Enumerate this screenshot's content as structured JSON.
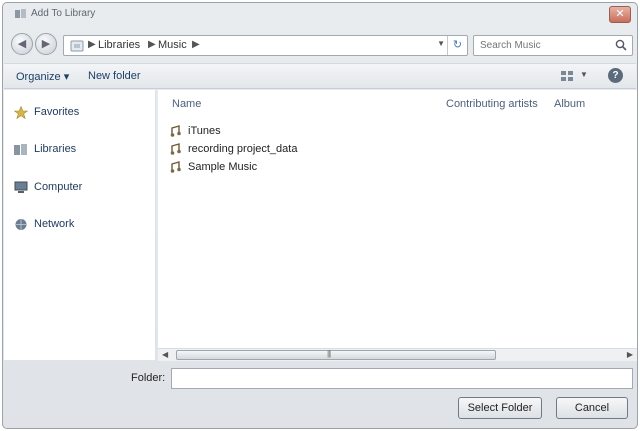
{
  "window": {
    "title": "Add To Library",
    "close_glyph": "✕"
  },
  "address": {
    "back_glyph": "◀",
    "forward_glyph": "▶",
    "separator": "▶",
    "crumbs": [
      "Libraries",
      "Music"
    ],
    "dropdown_glyph": "▼",
    "refresh_glyph": "↻"
  },
  "search": {
    "placeholder": "Search Music"
  },
  "toolbar": {
    "organize": "Organize ▾",
    "new_folder": "New folder",
    "view_arrow": "▼",
    "help": "?"
  },
  "nav": {
    "items": [
      {
        "label": "Favorites",
        "icon": "star-icon"
      },
      {
        "label": "Libraries",
        "icon": "libraries-icon"
      },
      {
        "label": "Computer",
        "icon": "computer-icon"
      },
      {
        "label": "Network",
        "icon": "network-icon"
      }
    ]
  },
  "files": {
    "columns": [
      "Name",
      "Contributing artists",
      "Album"
    ],
    "items": [
      "iTunes",
      "recording project_data",
      "Sample Music"
    ]
  },
  "scroll": {
    "left": "◀",
    "right": "▶",
    "grip": "|||"
  },
  "bottom": {
    "folder_label": "Folder:",
    "folder_value": "",
    "select_button": "Select Folder",
    "cancel_button": "Cancel"
  },
  "colors": {
    "link": "#1e3f66",
    "music_folder": "#c8a15a"
  }
}
